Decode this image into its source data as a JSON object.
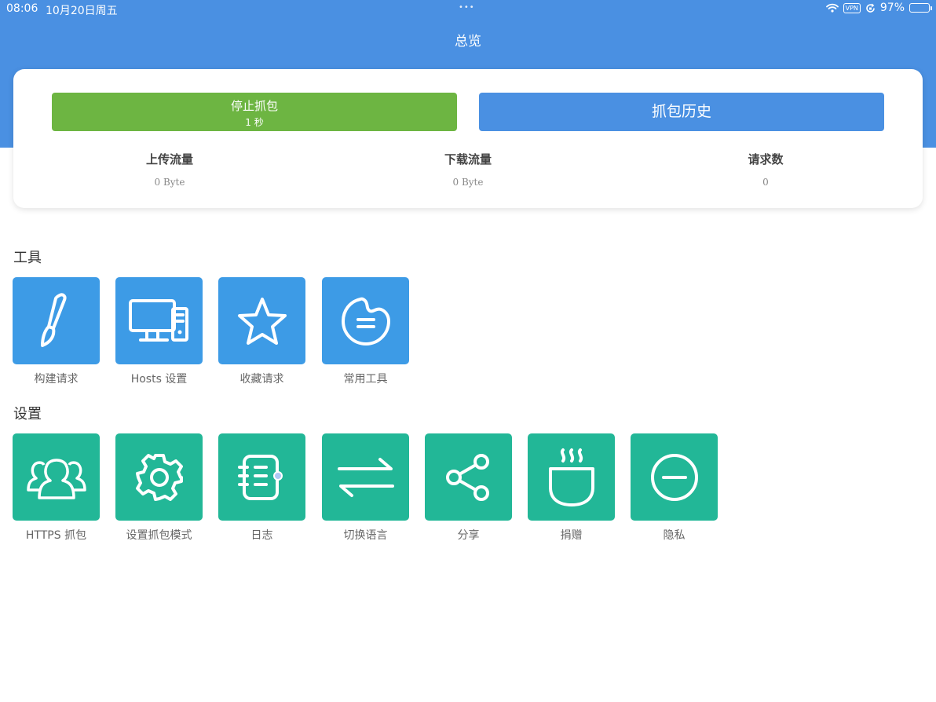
{
  "status_bar": {
    "time": "08:06",
    "date": "10月20日周五",
    "vpn": "VPN",
    "battery_percent": "97%",
    "battery_level": 0.97,
    "multitask_dots": "•••"
  },
  "nav": {
    "title": "总览"
  },
  "capture_card": {
    "stop_button": {
      "label": "停止抓包",
      "timer": "1 秒"
    },
    "history_button": {
      "label": "抓包历史"
    },
    "stats": [
      {
        "label": "上传流量",
        "value": "0 Byte"
      },
      {
        "label": "下载流量",
        "value": "0 Byte"
      },
      {
        "label": "请求数",
        "value": "0"
      }
    ]
  },
  "tools": {
    "title": "工具",
    "items": [
      {
        "label": "构建请求",
        "icon": "brush-icon"
      },
      {
        "label": "Hosts 设置",
        "icon": "computer-icon"
      },
      {
        "label": "收藏请求",
        "icon": "star-icon"
      },
      {
        "label": "常用工具",
        "icon": "palette-icon"
      }
    ]
  },
  "settings": {
    "title": "设置",
    "items": [
      {
        "label": "HTTPS 抓包",
        "icon": "users-icon"
      },
      {
        "label": "设置抓包模式",
        "icon": "gear-icon"
      },
      {
        "label": "日志",
        "icon": "notebook-icon"
      },
      {
        "label": "切换语言",
        "icon": "switch-arrows-icon"
      },
      {
        "label": "分享",
        "icon": "share-icon"
      },
      {
        "label": "捐赠",
        "icon": "coffee-cup-icon"
      },
      {
        "label": "隐私",
        "icon": "minus-circle-icon"
      }
    ]
  },
  "colors": {
    "header": "#4a90e2",
    "stop_button": "#6db542",
    "history_button": "#4a90e2",
    "tool_tile": "#3d9be6",
    "setting_tile": "#22b797"
  }
}
